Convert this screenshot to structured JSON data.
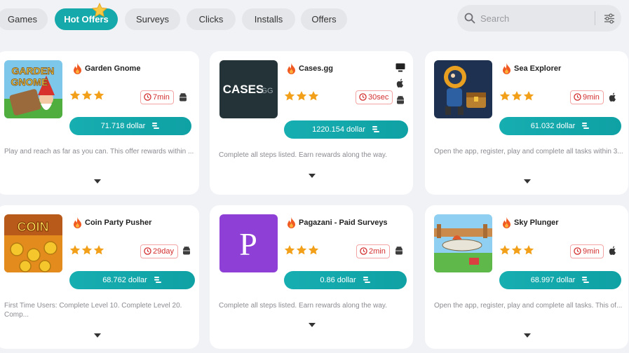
{
  "tabs": [
    {
      "label": "Games"
    },
    {
      "label": "Hot Offers"
    },
    {
      "label": "Surveys"
    },
    {
      "label": "Clicks"
    },
    {
      "label": "Installs"
    },
    {
      "label": "Offers"
    }
  ],
  "search": {
    "placeholder": "Search"
  },
  "colors": {
    "accent": "#16a9ac",
    "time_badge": "#d32f2f",
    "star": "#f2a019",
    "fire": "#f05a22"
  },
  "offers": [
    {
      "title": "Garden Gnome",
      "time": "7min",
      "reward": "71.718 dollar",
      "rating": 3,
      "platforms": [
        "android-icon"
      ],
      "description": "Play and reach as far as you can. This offer rewards within ...",
      "image_text": "GARDEN GNOME"
    },
    {
      "title": "Cases.gg",
      "time": "30sec",
      "reward": "1220.154 dollar",
      "rating": 3,
      "platforms": [
        "desktop-icon",
        "apple-icon",
        "android-icon"
      ],
      "description": "Complete all steps listed. Earn rewards along the way.",
      "image_text": "CASES",
      "image_subtext": "GG"
    },
    {
      "title": "Sea Explorer",
      "time": "9min",
      "reward": "61.032 dollar",
      "rating": 3,
      "platforms": [
        "apple-icon"
      ],
      "description": "Open the app, register, play and complete all tasks within 3...",
      "image_text": ""
    },
    {
      "title": "Coin Party Pusher",
      "time": "29day",
      "reward": "68.762 dollar",
      "rating": 3,
      "platforms": [
        "android-icon"
      ],
      "description": "First Time Users: Complete Level 10. Complete Level 20. Comp...",
      "image_text": "COIN"
    },
    {
      "title": "Pagazani - Paid Surveys",
      "time": "2min",
      "reward": "0.86 dollar",
      "rating": 3,
      "platforms": [
        "android-icon"
      ],
      "description": "Complete all steps listed. Earn rewards along the way.",
      "image_text": "P"
    },
    {
      "title": "Sky Plunger",
      "time": "9min",
      "reward": "68.997 dollar",
      "rating": 3,
      "platforms": [
        "apple-icon"
      ],
      "description": "Open the app, register, play and complete all tasks. This of...",
      "image_text": ""
    }
  ]
}
